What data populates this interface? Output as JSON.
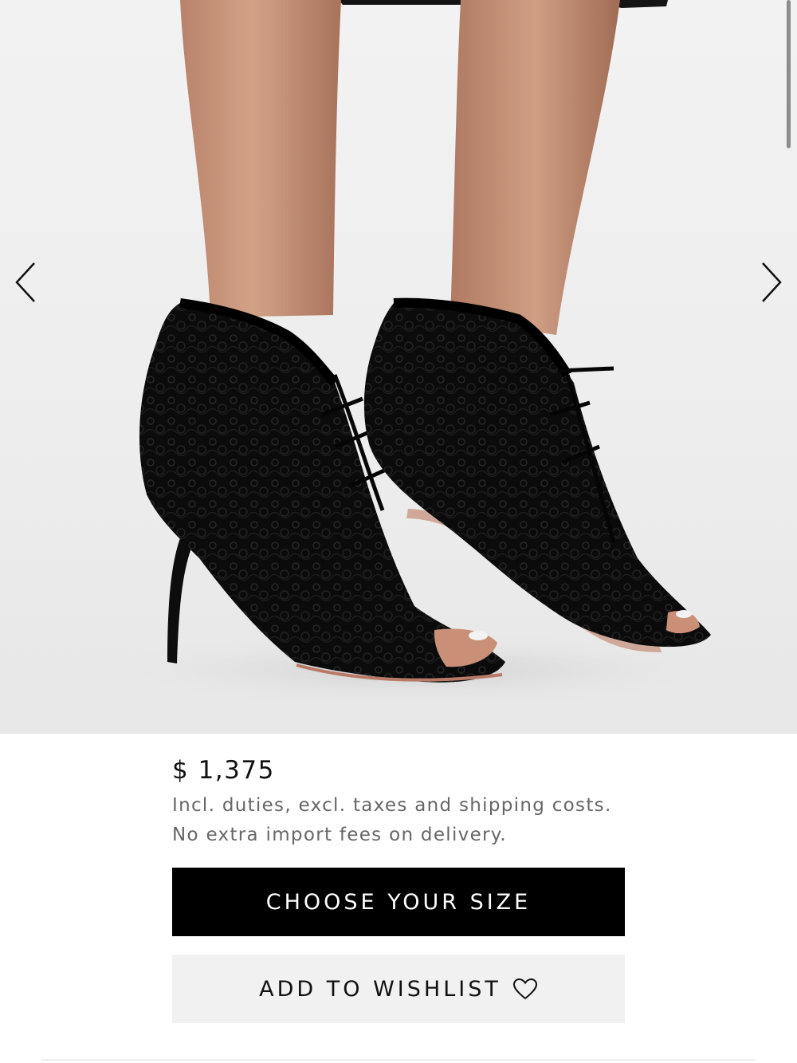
{
  "gallery": {
    "prev_icon": "chevron-left-icon",
    "next_icon": "chevron-right-icon"
  },
  "product": {
    "price": "$ 1,375",
    "price_note_line1": "Incl. duties, excl. taxes and shipping costs.",
    "price_note_line2": "No extra import fees on delivery."
  },
  "actions": {
    "choose_size_label": "CHOOSE YOUR SIZE",
    "wishlist_label": "ADD TO WISHLIST",
    "wishlist_icon": "heart-icon"
  },
  "colors": {
    "primary_button": "#000000",
    "secondary_button": "#f1f1f1",
    "price_note": "#666666"
  }
}
